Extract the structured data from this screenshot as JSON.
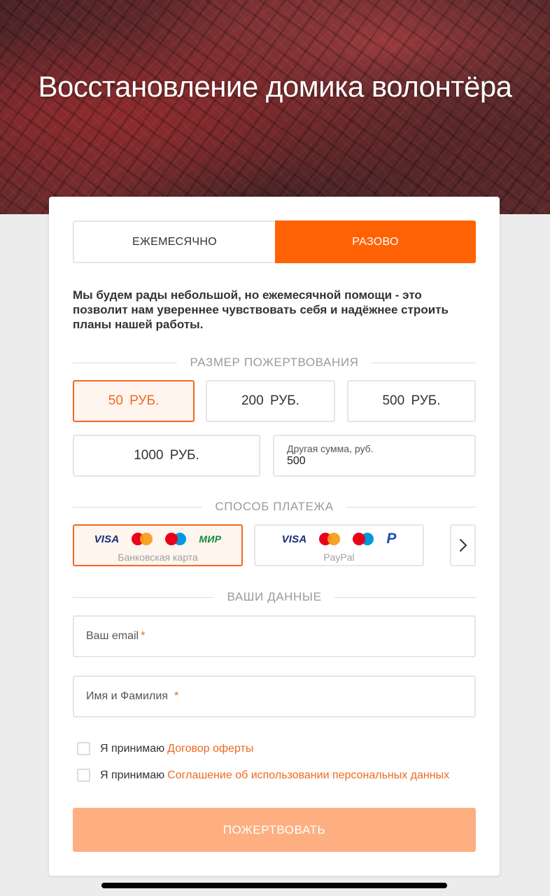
{
  "hero": {
    "title": "Восстановление домика волонтёра"
  },
  "tabs": {
    "monthly": "ЕЖЕМЕСЯЧНО",
    "once": "РАЗОВО",
    "active": "once"
  },
  "description": "Мы будем рады небольшой, но ежемесячной помощи - это позволит нам увереннее чувствовать себя и надёжнее строить планы нашей работы.",
  "amount": {
    "heading": "РАЗМЕР ПОЖЕРТВОВАНИЯ",
    "options": [
      "50 РУБ.",
      "200 РУБ.",
      "500 РУБ.",
      "1000 РУБ."
    ],
    "selected_index": 0,
    "other_label": "Другая сумма, руб.",
    "other_value": "500"
  },
  "payment": {
    "heading": "СПОСОБ ПЛАТЕЖА",
    "methods": [
      {
        "label": "Банковская карта",
        "logos": [
          "visa",
          "mastercard",
          "maestro",
          "mir"
        ],
        "mir_text": "МИР",
        "visa_text": "VISA"
      },
      {
        "label": "PayPal",
        "logos": [
          "visa",
          "mastercard",
          "maestro",
          "paypal"
        ],
        "visa_text": "VISA",
        "paypal_text": "P"
      }
    ],
    "selected_index": 0,
    "next_icon": "chevron-right-icon"
  },
  "user": {
    "heading": "ВАШИ ДАННЫЕ",
    "email_placeholder": "Ваш email",
    "name_placeholder": "Имя и Фамилия",
    "required_mark": "*"
  },
  "consents": [
    {
      "prefix": "Я принимаю",
      "link": "Договор оферты"
    },
    {
      "prefix": "Я принимаю",
      "link": "Соглашение об использовании персональных данных"
    }
  ],
  "submit_label": "ПОЖЕРТВОВАТЬ",
  "colors": {
    "accent": "#ff6205",
    "accent_text": "#ee6a20",
    "submit_disabled": "#fdaf82"
  }
}
